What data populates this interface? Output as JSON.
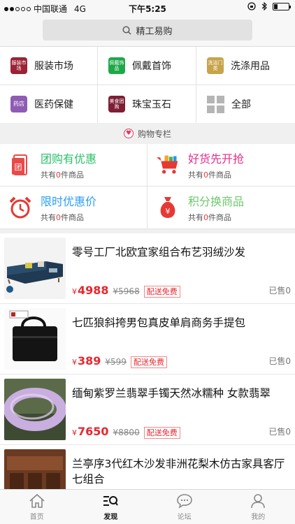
{
  "status_bar": {
    "carrier": "中国联通",
    "network": "4G",
    "time": "下午5:25",
    "signal_bars": 2,
    "battery_level": 0.25
  },
  "search": {
    "placeholder": "精工易购"
  },
  "categories": [
    {
      "label": "服装市场",
      "icon": "clothing-market-icon",
      "icon_text": "服装市场",
      "color": "#9b2335"
    },
    {
      "label": "佩戴首饰",
      "icon": "accessories-icon",
      "icon_text": "佩戴饰品",
      "color": "#1fa84a"
    },
    {
      "label": "洗涤用品",
      "icon": "detergent-icon",
      "icon_text": "洗洁门类",
      "color": "#c7a34a"
    },
    {
      "label": "医药保健",
      "icon": "pharmacy-icon",
      "icon_text": "药店",
      "color": "#8e5bb5"
    },
    {
      "label": "珠宝玉石",
      "icon": "jewelry-icon",
      "icon_text": "美食团购",
      "color": "#7d1f35"
    },
    {
      "label": "全部",
      "icon": "all-categories-icon",
      "icon_text": "",
      "color": "#b5b5b5"
    }
  ],
  "section": {
    "title": "购物专栏"
  },
  "promos": [
    {
      "title": "团购有优惠",
      "sub_prefix": "共有",
      "count": "0",
      "sub_suffix": "件商品",
      "color": "#2bbf6a",
      "icon": "group-buy-ticket-icon"
    },
    {
      "title": "好货先开抢",
      "sub_prefix": "共有",
      "count": "0",
      "sub_suffix": "件商品",
      "color": "#e62e8a",
      "icon": "shopping-cart-icon"
    },
    {
      "title": "限时优惠价",
      "sub_prefix": "共有",
      "count": "0",
      "sub_suffix": "件商品",
      "color": "#2b9ff2",
      "icon": "alarm-clock-icon"
    },
    {
      "title": "积分换商品",
      "sub_prefix": "共有",
      "count": "0",
      "sub_suffix": "件商品",
      "color": "#6cc96a",
      "icon": "money-bag-icon"
    }
  ],
  "products": [
    {
      "title": "零号工厂北欧宜家组合布艺羽绒沙发",
      "currency": "¥",
      "price": "4988",
      "old_price": "¥5968",
      "shipping": "配送免费",
      "sold": "已售0",
      "image": "sofa-image"
    },
    {
      "title": "七匹狼斜挎男包真皮单肩商务手提包",
      "currency": "¥",
      "price": "389",
      "old_price": "¥599",
      "shipping": "配送免费",
      "sold": "已售0",
      "image": "handbag-image"
    },
    {
      "title": "缅甸紫罗兰翡翠手镯天然冰糯种 女款翡翠",
      "currency": "¥",
      "price": "7650",
      "old_price": "¥8800",
      "shipping": "配送免费",
      "sold": "已售0",
      "image": "jade-bracelet-image"
    },
    {
      "title": "兰亭序3代红木沙发非洲花梨木仿古家具客厅七组合",
      "currency": "¥",
      "price": "",
      "old_price": "",
      "shipping": "",
      "sold": "",
      "image": "mahogany-furniture-image"
    }
  ],
  "tabs": [
    {
      "label": "首页",
      "icon": "home-icon",
      "active": false
    },
    {
      "label": "发现",
      "icon": "discover-icon",
      "active": true
    },
    {
      "label": "论坛",
      "icon": "forum-icon",
      "active": false
    },
    {
      "label": "我的",
      "icon": "profile-icon",
      "active": false
    }
  ]
}
